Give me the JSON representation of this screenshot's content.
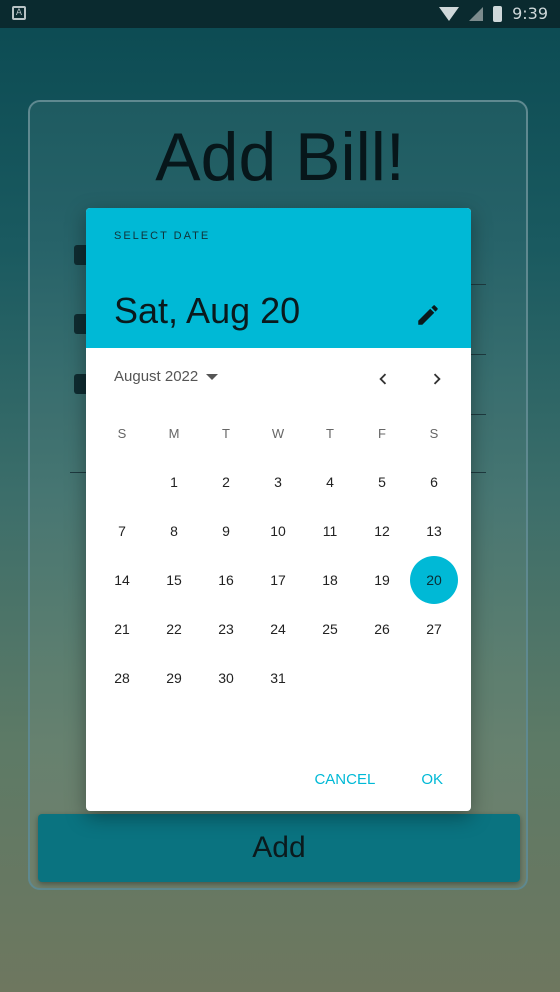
{
  "status_bar": {
    "time": "9:39",
    "app_icon": "A",
    "icons": [
      "wifi-icon",
      "signal-icon",
      "battery-icon"
    ]
  },
  "screen": {
    "title": "Add Bill!",
    "add_button_label": "Add"
  },
  "date_picker": {
    "header_label": "SELECT DATE",
    "selected_date": "Sat, Aug 20",
    "month_year": "August 2022",
    "weekdays": [
      "S",
      "M",
      "T",
      "W",
      "T",
      "F",
      "S"
    ],
    "days": [
      "1",
      "2",
      "3",
      "4",
      "5",
      "6",
      "7",
      "8",
      "9",
      "10",
      "11",
      "12",
      "13",
      "14",
      "15",
      "16",
      "17",
      "18",
      "19",
      "20",
      "21",
      "22",
      "23",
      "24",
      "25",
      "26",
      "27",
      "28",
      "29",
      "30",
      "31"
    ],
    "selected_day": "20",
    "cancel_label": "CANCEL",
    "ok_label": "OK",
    "accent_color": "#00b9d6"
  }
}
